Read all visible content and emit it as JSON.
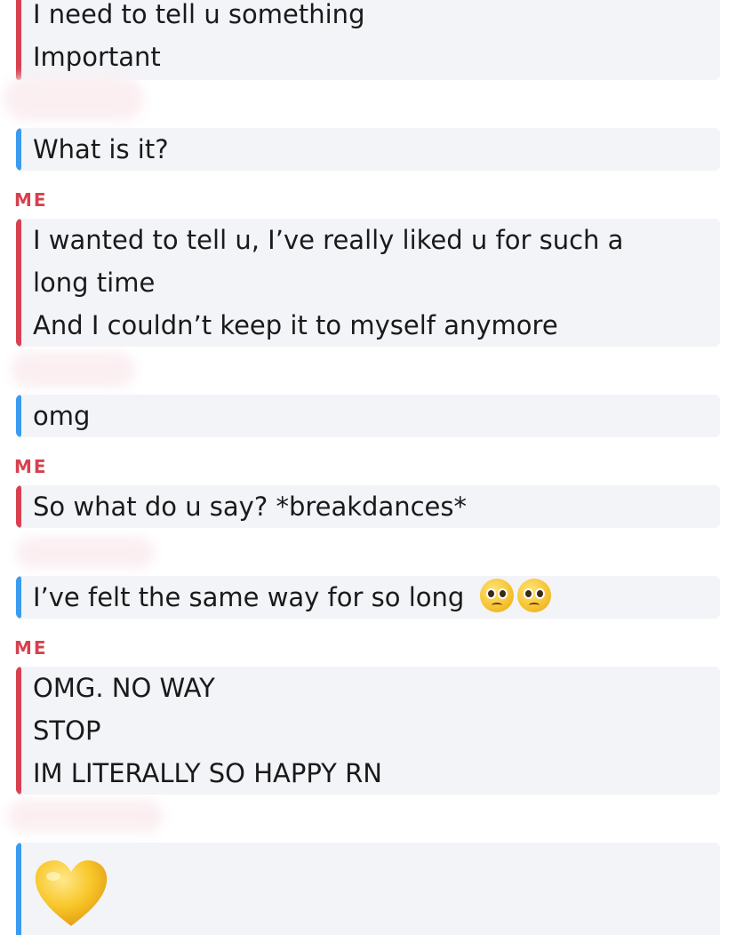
{
  "colors": {
    "me_accent": "#d8404f",
    "them_accent": "#3a9bf0",
    "bubble_bg": "#f3f4f8"
  },
  "sender_me_label": "ME",
  "messages": [
    {
      "from": "them",
      "lines": [
        "I need to tell u something",
        "Important"
      ]
    },
    {
      "from": "them",
      "lines": [
        "What is it?"
      ]
    },
    {
      "from": "me",
      "lines": [
        "I wanted to tell u, I’ve really liked u for such a",
        "long time",
        "And I couldn’t keep it to myself anymore"
      ]
    },
    {
      "from": "them",
      "lines": [
        "omg"
      ]
    },
    {
      "from": "me",
      "lines": [
        "So what do u say? *breakdances*"
      ]
    },
    {
      "from": "them",
      "lines": [
        "I’ve felt the same way for so long"
      ],
      "emojis": [
        "pleading-face-emoji",
        "pleading-face-emoji"
      ]
    },
    {
      "from": "me",
      "lines": [
        "OMG. NO WAY",
        "STOP",
        "IM LITERALLY SO HAPPY RN"
      ]
    },
    {
      "from": "them",
      "emojis": [
        "yellow-heart-emoji"
      ]
    }
  ]
}
